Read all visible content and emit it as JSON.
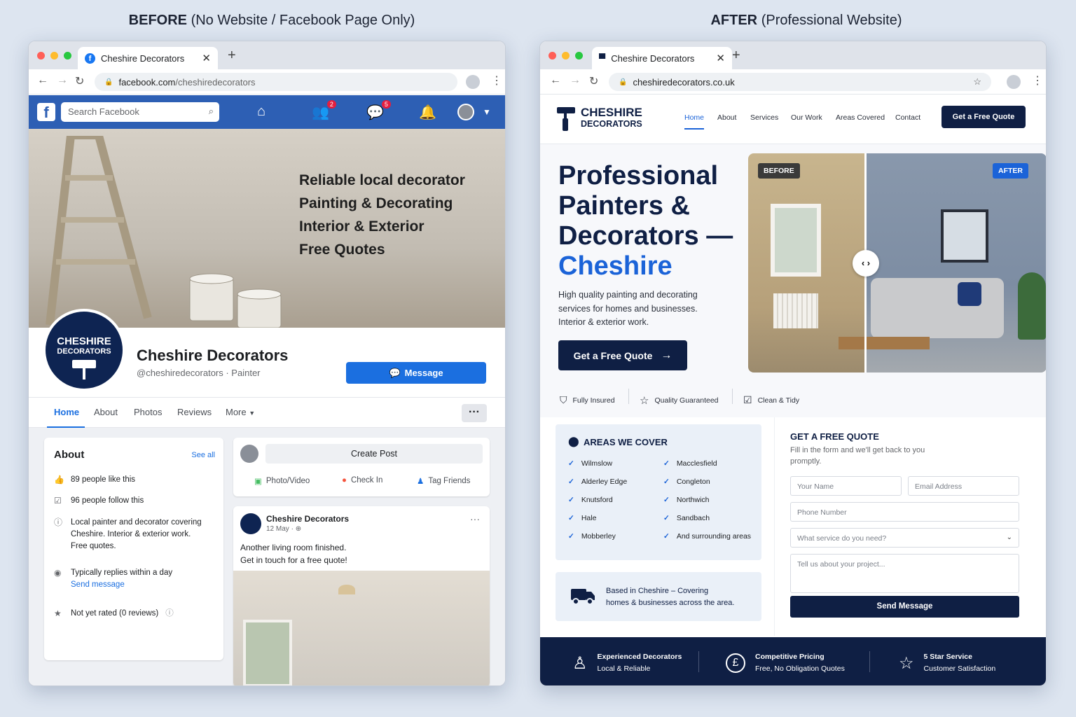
{
  "headings": {
    "before_bold": "BEFORE",
    "before_rest": "(No Website / Facebook Page Only)",
    "after_bold": "AFTER",
    "after_rest": "(Professional Website)"
  },
  "facebook": {
    "tab_title": "Cheshire Decorators",
    "url_domain": "facebook.com",
    "url_path": "/cheshiredecorators",
    "search_placeholder": "Search Facebook",
    "friends_badge": "2",
    "messenger_badge": "5",
    "cover_lines": [
      "Reliable local decorator",
      "Painting & Decorating",
      "Interior & Exterior",
      "Free Quotes"
    ],
    "logo_line1": "CHESHIRE",
    "logo_line2": "DECORATORS",
    "page_name": "Cheshire Decorators",
    "handle": "@cheshiredecorators · Painter",
    "message_label": "Message",
    "tabs": [
      "Home",
      "About",
      "Photos",
      "Reviews",
      "More"
    ],
    "more_dots": "···",
    "about": {
      "title": "About",
      "see_all": "See all",
      "likes": "89 people like this",
      "follows": "96 people follow this",
      "desc_1": "Local painter and decorator covering",
      "desc_2": "Cheshire. Interior & exterior work.",
      "desc_3": "Free quotes.",
      "replies": "Typically replies within a day",
      "send_message": "Send message",
      "rating": "Not yet rated (0 reviews)"
    },
    "create_post": "Create Post",
    "actions": [
      "Photo/Video",
      "Check In",
      "Tag Friends"
    ],
    "post": {
      "author": "Cheshire Decorators",
      "date": "12 May ·",
      "line1": "Another living room finished.",
      "line2": "Get in touch for a free quote!"
    }
  },
  "site": {
    "tab_title": "Cheshire Decorators",
    "url": "cheshiredecorators.co.uk",
    "brand_line1": "CHESHIRE",
    "brand_line2": "DECORATORS",
    "nav": [
      "Home",
      "About",
      "Services",
      "Our Work",
      "Areas Covered",
      "Contact"
    ],
    "header_cta": "Get a Free Quote",
    "hero_title": [
      "Professional",
      "Painters &",
      "Decorators —"
    ],
    "hero_title_accent": "Cheshire",
    "hero_sub": "High quality painting and decorating services for homes and businesses. Interior & exterior work.",
    "hero_cta": "Get a Free Quote",
    "before_label": "BEFORE",
    "after_label": "AFTER",
    "trust": [
      "Fully Insured",
      "Quality Guaranteed",
      "Clean & Tidy"
    ],
    "areas_title": "AREAS WE COVER",
    "areas_left": [
      "Wilmslow",
      "Alderley Edge",
      "Knutsford",
      "Hale",
      "Mobberley"
    ],
    "areas_right": [
      "Macclesfield",
      "Congleton",
      "Northwich",
      "Sandbach",
      "And surrounding areas"
    ],
    "based_line1": "Based in Cheshire – Covering",
    "based_line2": "homes & businesses across the area.",
    "quote_title": "GET A FREE QUOTE",
    "quote_sub": "Fill in the form and we'll get back to you promptly.",
    "fields": {
      "name": "Your Name",
      "email": "Email Address",
      "phone": "Phone Number",
      "service": "What service do you need?",
      "project": "Tell us about your project..."
    },
    "send": "Send Message",
    "footer": [
      {
        "title": "Experienced Decorators",
        "sub": "Local & Reliable"
      },
      {
        "title": "Competitive Pricing",
        "sub": "Free, No Obligation Quotes"
      },
      {
        "title": "5 Star Service",
        "sub": "Customer Satisfaction"
      }
    ]
  }
}
